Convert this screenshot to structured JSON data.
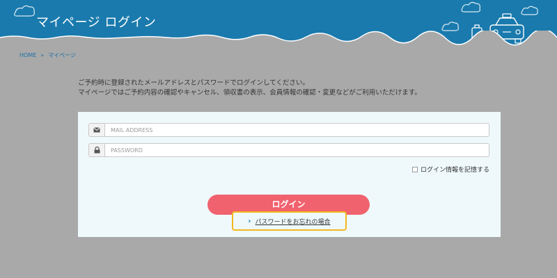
{
  "header": {
    "title": "マイページ ログイン",
    "bg_color": "#1a7aad"
  },
  "breadcrumb": {
    "home": "HOME",
    "separator": "»",
    "current": "マイページ"
  },
  "intro": {
    "line1": "ご予約時に登録されたメールアドレスとパスワードでログインしてください。",
    "line2": "マイページではご予約内容の確認やキャンセル、領収書の表示、会員情報の確認・変更などがご利用いただけます。"
  },
  "form": {
    "email_placeholder": "MAIL ADDRESS",
    "email_icon": "envelope-icon",
    "password_placeholder": "PASSWORD",
    "password_icon": "lock-icon",
    "remember_label": "ログイン情報を記憶する",
    "remember_checked": false,
    "login_label": "ログイン",
    "login_color": "#f0626e",
    "forgot_label": "パスワードをお忘れの場合"
  }
}
